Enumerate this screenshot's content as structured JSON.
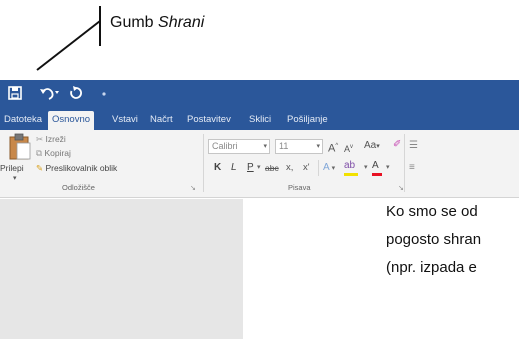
{
  "annotation": {
    "prefix": "Gumb ",
    "emphasis": "Shrani"
  },
  "qat": {
    "save_icon": "save-icon",
    "undo_icon": "undo-icon",
    "redo_icon": "redo-icon",
    "customize_icon": "dot-icon"
  },
  "tabs": [
    "Datoteka",
    "Osnovno",
    "Vstavi",
    "Načrt",
    "Postavitev",
    "Sklici",
    "Pošiljanje"
  ],
  "active_tab": "Osnovno",
  "clipboard": {
    "paste": "Prilepi",
    "cut": "Izreži",
    "copy": "Kopiraj",
    "format_painter": "Preslikovalnik oblik",
    "group": "Odložišče"
  },
  "font": {
    "name": "Calibri",
    "size": "11",
    "grow": "A",
    "shrink": "A",
    "case": "Aa",
    "bold": "K",
    "italic": "L",
    "underline": "P",
    "strike": "abc",
    "subscript": "x,",
    "superscript": "x'",
    "group": "Pisava"
  },
  "document": {
    "lines": [
      "Ko smo se od",
      "pogosto shran",
      "(npr. izpada e"
    ]
  },
  "colors": {
    "ribbon_blue": "#2b579a",
    "ribbon_bg": "#f3f3f3",
    "highlight": "#f2e100",
    "font_color": "#e81123"
  }
}
